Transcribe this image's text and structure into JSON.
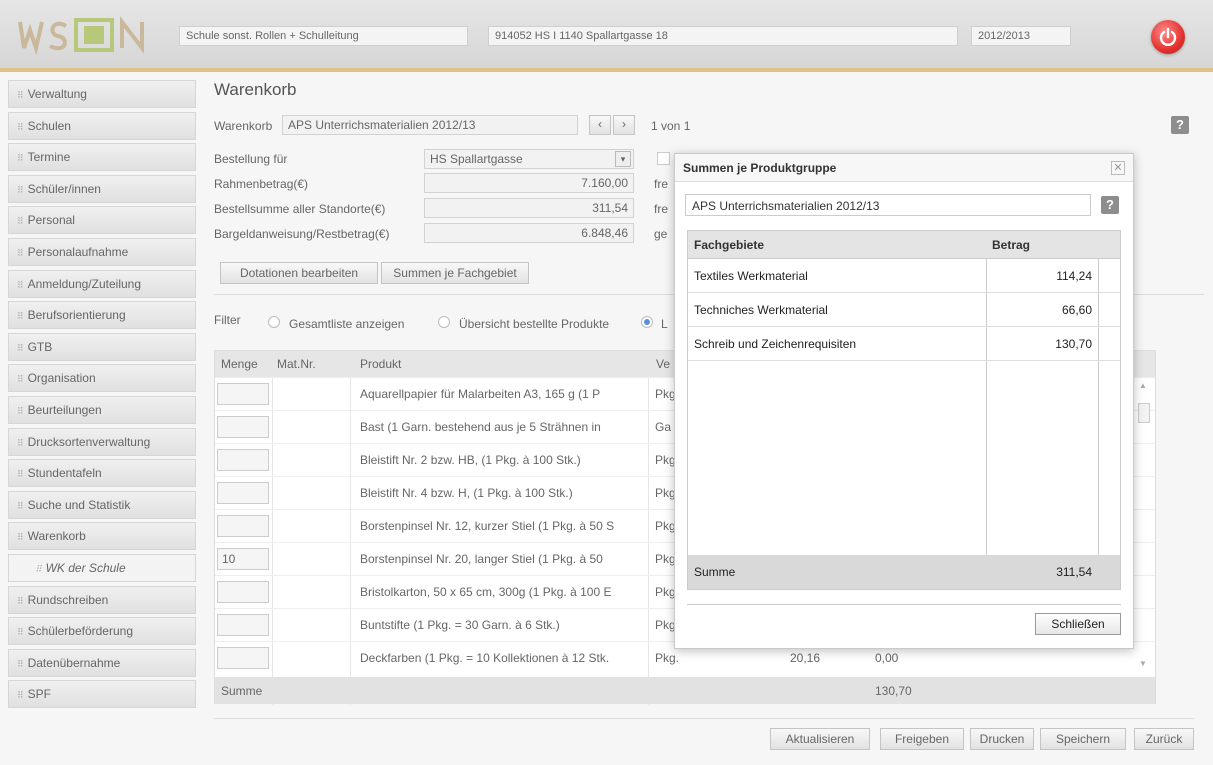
{
  "header": {
    "school_type": "Schule sonst. Rollen + Schulleitung",
    "school": "914052 HS I 1140 Spallartgasse 18",
    "year": "2012/2013"
  },
  "sidebar": {
    "items": [
      {
        "label": "Verwaltung"
      },
      {
        "label": "Schulen"
      },
      {
        "label": "Termine"
      },
      {
        "label": "Schüler/innen"
      },
      {
        "label": "Personal"
      },
      {
        "label": "Personalaufnahme"
      },
      {
        "label": "Anmeldung/Zuteilung"
      },
      {
        "label": "Berufsorientierung"
      },
      {
        "label": "GTB"
      },
      {
        "label": "Organisation"
      },
      {
        "label": "Beurteilungen"
      },
      {
        "label": "Drucksortenverwaltung"
      },
      {
        "label": "Stundentafeln"
      },
      {
        "label": "Suche und Statistik"
      },
      {
        "label": "Warenkorb"
      },
      {
        "label": "WK der Schule"
      },
      {
        "label": "Rundschreiben"
      },
      {
        "label": "Schülerbeförderung"
      },
      {
        "label": "Datenübernahme"
      },
      {
        "label": "SPF"
      }
    ]
  },
  "main": {
    "title": "Warenkorb",
    "cart_label": "Warenkorb",
    "cart_value": "APS Unterrichsmaterialien 2012/13",
    "pager": "1 von 1",
    "order_for_label": "Bestellung für",
    "order_for_value": "HS Spallartgasse",
    "frame_label": "Rahmenbetrag(€)",
    "frame_value": "7.160,00",
    "sum_label": "Bestellsumme aller Standorte(€)",
    "sum_value": "311,54",
    "cash_label": "Bargeldanweisung/Restbetrag(€)",
    "cash_value": "6.848,46",
    "right_lbl_1": "fre",
    "right_lbl_2": "fre",
    "right_lbl_3": "ge",
    "btn_dotations": "Dotationen bearbeiten",
    "btn_sums": "Summen je Fachgebiet",
    "filter_label": "Filter",
    "filter_opt1": "Gesamtliste anzeigen",
    "filter_opt2": "Übersicht bestellte Produkte",
    "filter_opt3": "L"
  },
  "table": {
    "headers": {
      "qty": "Menge",
      "mat": "Mat.Nr.",
      "product": "Produkt",
      "unit": "Ve"
    },
    "rows": [
      {
        "qty": "",
        "product": "Aquarellpapier für Malarbeiten A3, 165 g (1 P",
        "unit": "Pkg"
      },
      {
        "qty": "",
        "product": "Bast (1 Garn. bestehend aus je 5 Strähnen in",
        "unit": "Ga"
      },
      {
        "qty": "",
        "product": "Bleistift Nr. 2 bzw. HB, (1 Pkg. à 100 Stk.)",
        "unit": "Pkg"
      },
      {
        "qty": "",
        "product": "Bleistift Nr. 4 bzw. H, (1 Pkg. à 100 Stk.)",
        "unit": "Pkg"
      },
      {
        "qty": "",
        "product": "Borstenpinsel Nr. 12, kurzer Stiel (1 Pkg. à 50 S",
        "unit": "Pkg"
      },
      {
        "qty": "10",
        "product": "Borstenpinsel Nr. 20, langer Stiel (1 Pkg. à 50",
        "unit": "Pkg"
      },
      {
        "qty": "",
        "product": "Bristolkarton, 50 x 65 cm, 300g (1 Pkg. à 100 E",
        "unit": "Pkg"
      },
      {
        "qty": "",
        "product": "Buntstifte (1 Pkg. = 30 Garn. à 6 Stk.)",
        "unit": "Pkg"
      },
      {
        "qty": "",
        "product": "Deckfarben (1 Pkg. = 10 Kollektionen à 12 Stk.",
        "unit": "Pkg.",
        "price": "20,16",
        "total": "0,00"
      }
    ],
    "footer_label": "Summe",
    "footer_total": "130,70"
  },
  "modal": {
    "title": "Summen je Produktgruppe",
    "cart": "APS Unterrichsmaterialien 2012/13",
    "col_area": "Fachgebiete",
    "col_amount": "Betrag",
    "rows": [
      {
        "area": "Textiles Werkmaterial",
        "amount": "114,24"
      },
      {
        "area": "Techniches Werkmaterial",
        "amount": "66,60"
      },
      {
        "area": "Schreib und Zeichenrequisiten",
        "amount": "130,70"
      }
    ],
    "sum_label": "Summe",
    "sum_value": "311,54",
    "close_button": "Schließen"
  },
  "bottom_buttons": {
    "update": "Aktualisieren",
    "release": "Freigeben",
    "print": "Drucken",
    "save": "Speichern",
    "back": "Zurück"
  },
  "colors": {
    "header_accent": "#e0c18a",
    "power_button": "#e2322f",
    "radio_selected": "#5d8fd8"
  }
}
